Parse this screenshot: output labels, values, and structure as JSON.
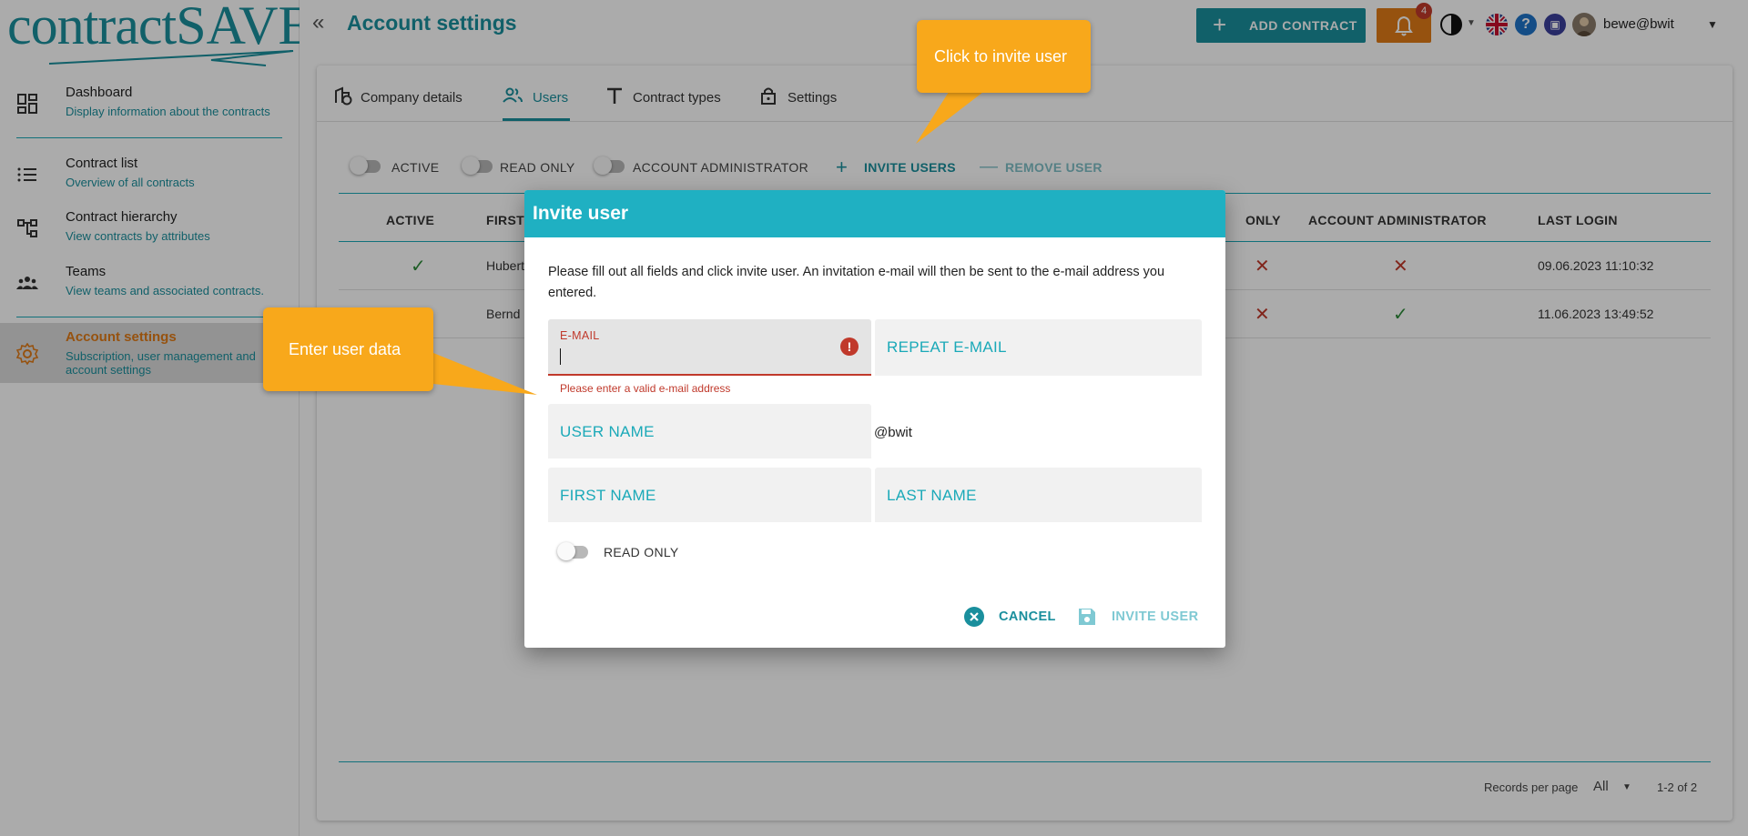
{
  "app": {
    "logo_text_main": "contract",
    "logo_text_accent": "SAVE"
  },
  "sidebar": {
    "items": [
      {
        "title": "Dashboard",
        "subtitle": "Display information about the contracts",
        "icon": "dashboard-icon"
      },
      {
        "title": "Contract list",
        "subtitle": "Overview of all contracts",
        "icon": "list-icon"
      },
      {
        "title": "Contract hierarchy",
        "subtitle": "View contracts by attributes",
        "icon": "hierarchy-icon"
      },
      {
        "title": "Teams",
        "subtitle": "View teams and associated contracts.",
        "icon": "people-icon"
      },
      {
        "title": "Account settings",
        "subtitle_line1": "Subscription, user management and",
        "subtitle_line2": "account settings",
        "icon": "gear-icon"
      }
    ]
  },
  "header": {
    "title": "Account settings",
    "add_contract_label": "ADD CONTRACT",
    "notification_count": "4",
    "user": "bewe@bwit"
  },
  "tabs": [
    {
      "label": "Company details"
    },
    {
      "label": "Users"
    },
    {
      "label": "Contract types"
    },
    {
      "label": "Settings"
    }
  ],
  "toolbar": {
    "active": "ACTIVE",
    "read_only": "READ ONLY",
    "account_admin": "ACCOUNT ADMINISTRATOR",
    "invite_users": "INVITE USERS",
    "remove_user": "REMOVE USER"
  },
  "table": {
    "headers": {
      "active": "ACTIVE",
      "first": "FIRST",
      "read_only": "ONLY",
      "admin": "ACCOUNT ADMINISTRATOR",
      "last_login": "LAST LOGIN"
    },
    "rows": [
      {
        "first": "Hubert",
        "last_login": "09.06.2023 11:10:32"
      },
      {
        "first": "Bernd",
        "last_login": "11.06.2023 13:49:52"
      }
    ],
    "footer": {
      "records_label": "Records per page",
      "records_value": "All",
      "range": "1-2 of 2"
    }
  },
  "dialog": {
    "title": "Invite user",
    "intro": "Please fill out all fields and click invite user. An invitation e-mail will then be sent to the e-mail address you entered.",
    "email_label": "E-MAIL",
    "repeat_email_label": "REPEAT E-MAIL",
    "email_error": "Please enter a valid e-mail address",
    "username_label": "USER NAME",
    "domain_suffix": "@bwit",
    "first_name_label": "FIRST NAME",
    "last_name_label": "LAST NAME",
    "read_only_label": "READ ONLY",
    "cancel_label": "CANCEL",
    "invite_label": "INVITE USER"
  },
  "callouts": {
    "invite": "Click to invite user",
    "enter": "Enter user data"
  },
  "colors": {
    "brand": "#1a8f9d",
    "dialog_header": "#1fb0c2",
    "accent_orange": "#e07b17",
    "callout": "#f8a81b",
    "error": "#c0392b"
  }
}
